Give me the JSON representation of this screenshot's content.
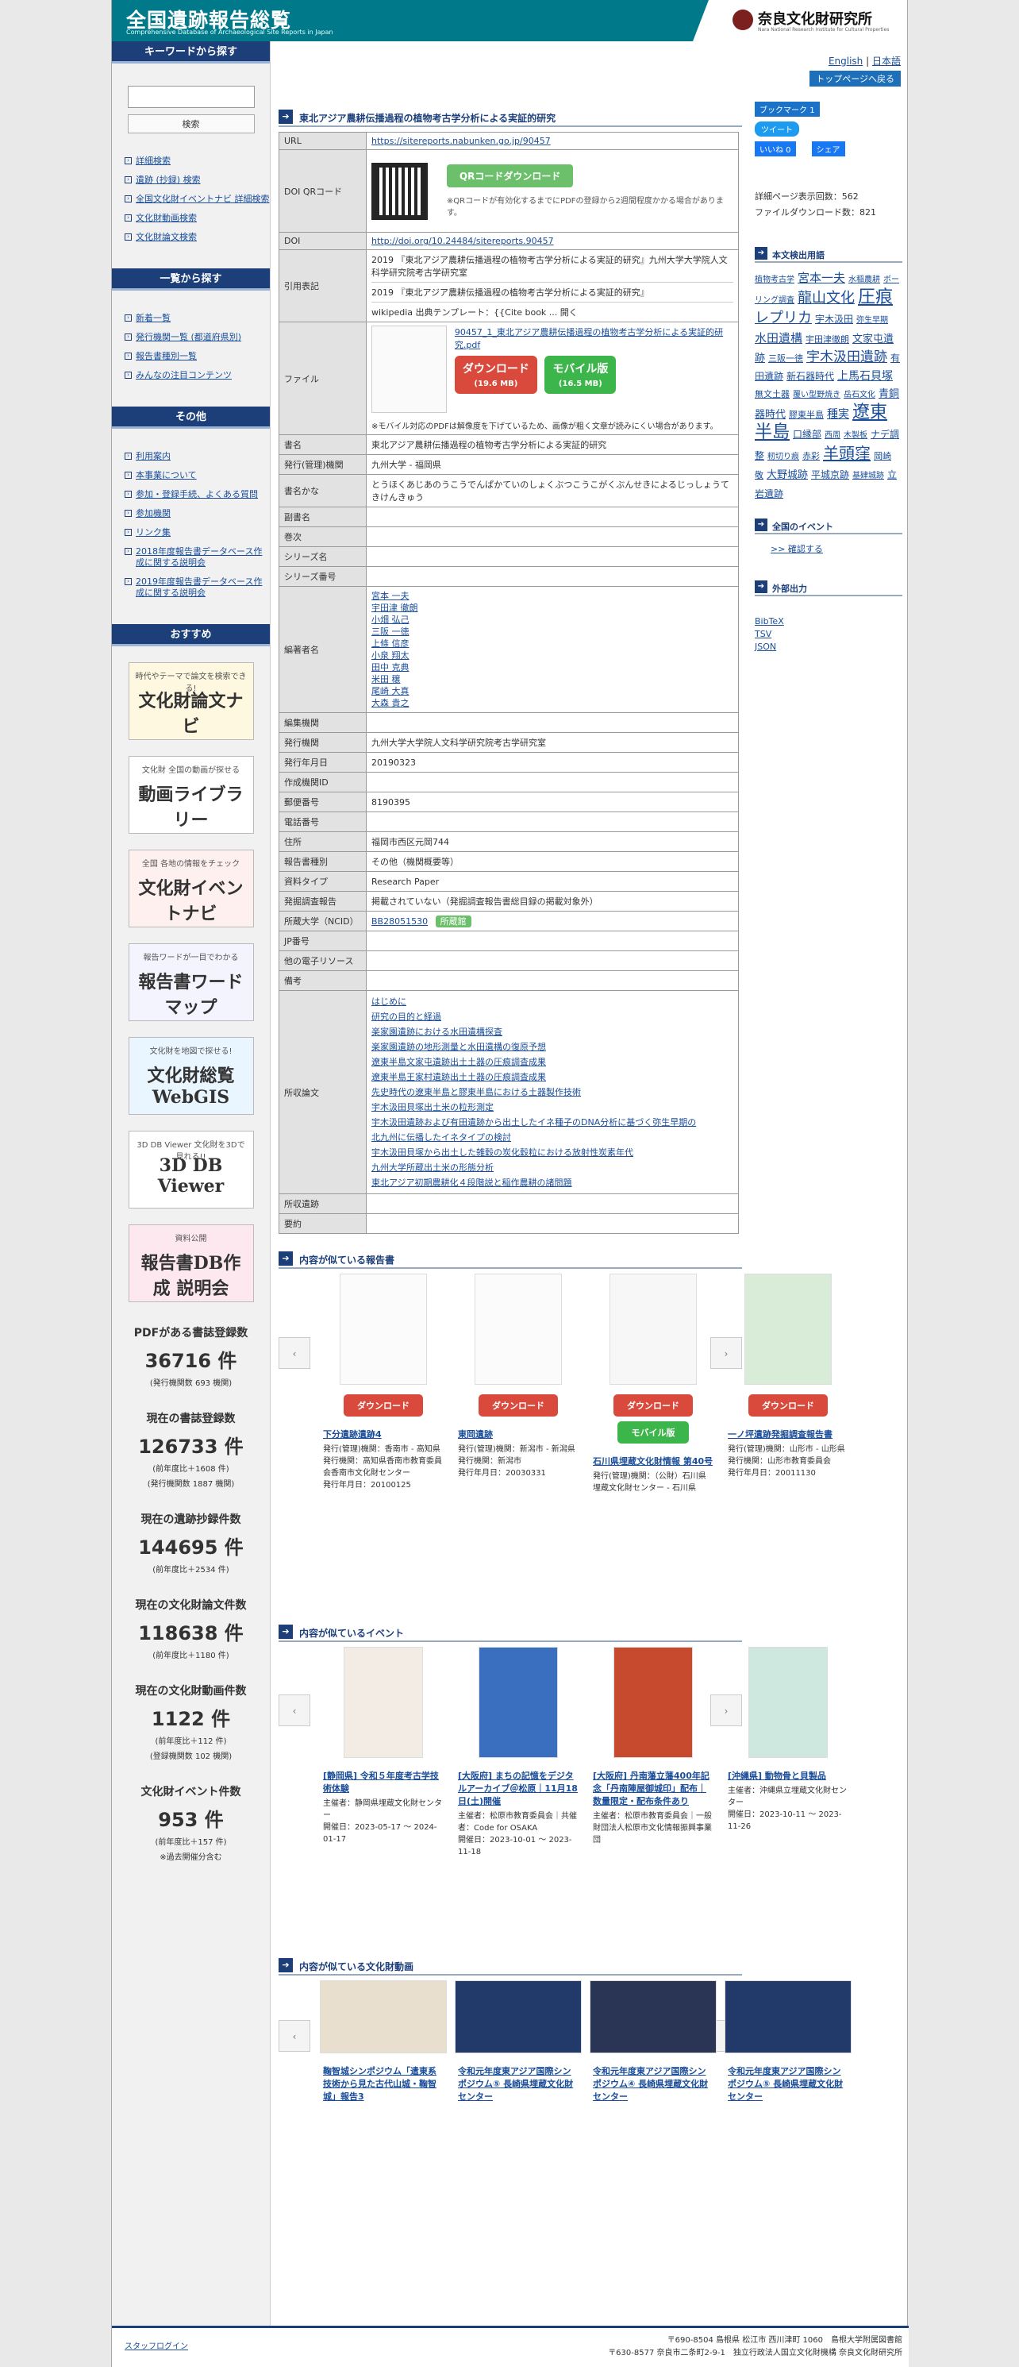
{
  "header": {
    "title": "全国遺跡報告総覧",
    "subtitle": "Comprehensive Database of Archaeological Site Reports in Japan",
    "org": "奈良文化財研究所",
    "org_sub": "Nara National Research Institute for Cultural Properties"
  },
  "lang": {
    "english": "English",
    "sep": "|",
    "japanese": "日本語",
    "top": "トップページへ戻る"
  },
  "sidebar": {
    "search_head": "キーワードから探す",
    "search_button": "検索",
    "search_links": [
      "詳細検索",
      "遺跡 (抄録) 検索",
      "全国文化財イベントナビ 詳細検索",
      "文化財動画検索",
      "文化財論文検索"
    ],
    "list_head": "一覧から探す",
    "list_links": [
      "新着一覧",
      "発行機関一覧 (都道府県別)",
      "報告書種別一覧",
      "みんなの注目コンテンツ"
    ],
    "other_head": "その他",
    "other_links": [
      "利用案内",
      "本事業について",
      "参加・登録手続、よくある質問",
      "参加機関",
      "リンク集",
      "2018年度報告書データベース作成に関する説明会",
      "2019年度報告書データベース作成に関する説明会"
    ],
    "recommend_head": "おすすめ",
    "banners": [
      {
        "small": "時代やテーマで論文を検索できる!",
        "main": "文化財論文ナビ"
      },
      {
        "small": "文化財 全国の動画が探せる",
        "main": "動画ライブラリー"
      },
      {
        "small": "全国 各地の情報をチェック",
        "main": "文化財イベントナビ"
      },
      {
        "small": "報告ワードが一目でわかる",
        "main": "報告書ワードマップ"
      },
      {
        "small": "文化財を地図で探せる!",
        "main": "文化財総覧WebGIS"
      },
      {
        "small": "3D DB Viewer 文化財を3Dで見れる!!",
        "main": "3D DB Viewer"
      },
      {
        "small": "資料公開",
        "main": "報告書DB作成 説明会"
      }
    ],
    "stats": [
      {
        "title": "PDFがある書誌登録数",
        "value": "36716 件",
        "notes": [
          "(発行機関数 693 機関)"
        ]
      },
      {
        "title": "現在の書誌登録数",
        "value": "126733 件",
        "notes": [
          "(前年度比＋1608 件)",
          "(発行機関数 1887 機関)"
        ]
      },
      {
        "title": "現在の遺跡抄録件数",
        "value": "144695 件",
        "notes": [
          "(前年度比＋2534 件)"
        ]
      },
      {
        "title": "現在の文化財論文件数",
        "value": "118638 件",
        "notes": [
          "(前年度比＋1180 件)"
        ]
      },
      {
        "title": "現在の文化財動画件数",
        "value": "1122 件",
        "notes": [
          "(前年度比＋112 件)",
          "(登録機関数 102 機関)"
        ]
      },
      {
        "title": "文化財イベント件数",
        "value": "953 件",
        "notes": [
          "(前年度比＋157 件)",
          "※過去開催分含む"
        ]
      }
    ]
  },
  "main": {
    "title": "東北アジア農耕伝播過程の植物考古学分析による実証的研究",
    "url": "https://sitereports.nabunken.go.jp/90457",
    "qr_button": "QRコードダウンロード",
    "qr_note": "※QRコードが有効化するまでにPDFの登録から2週間程度かかる場合があります。",
    "doi": "http://doi.org/10.24484/sitereports.90457",
    "cite1": "2019 『東北アジア農耕伝播過程の植物考古学分析による実証的研究』九州大学大学院人文科学研究院考古学研究室",
    "cite2": "2019 『東北アジア農耕伝播過程の植物考古学分析による実証的研究』",
    "cite3": "wikipedia 出典テンプレート：{{Cite book ... 開く",
    "file_link": "90457_1_東北アジア農耕伝播過程の植物考古学分析による実証的研究.pdf",
    "dl_label": "ダウンロード",
    "dl_size": "(19.6 MB)",
    "mob_label": "モバイル版",
    "mob_size": "(16.5 MB)",
    "file_note": "※モバイル対応のPDFは解像度を下げているため、画像が粗く文章が読みにくい場合があります。",
    "labels": {
      "url": "URL",
      "qr": "DOI QRコード",
      "doi": "DOI",
      "cite": "引用表記",
      "file": "ファイル",
      "book": "書名",
      "pub": "発行(管理)機関",
      "kana": "書名かな",
      "subtitle": "副書名",
      "vol": "巻次",
      "series": "シリーズ名",
      "seriesno": "シリーズ番号",
      "editors": "編著者名",
      "editorg": "編集機関",
      "issuer": "発行機関",
      "date": "発行年月日",
      "org_id": "作成機関ID",
      "zip": "郵便番号",
      "tel": "電話番号",
      "addr": "住所",
      "type": "報告書種別",
      "material": "資料タイプ",
      "survey": "発掘調査報告",
      "ncid": "所蔵大学（NCID）",
      "jp": "JP番号",
      "elec": "他の電子リソース",
      "note": "備考",
      "contents": "所収論文",
      "sites": "所収遺跡",
      "summary": "要約"
    },
    "book": "東北アジア農耕伝播過程の植物考古学分析による実証的研究",
    "pub": "九州大学 - 福岡県",
    "kana": "とうほくあじあのうこうでんぱかていのしょくぶつこうこがくぶんせきによるじっしょうてきけんきゅう",
    "editors": [
      "宮本 一夫",
      "宇田津 徹朗",
      "小畑 弘己",
      "三阪 一徳",
      "上條 信彦",
      "小泉 翔太",
      "田中 克典",
      "米田 穣",
      "尾崎 大真",
      "大森 貴之"
    ],
    "issuer": "九州大学大学院人文科学研究院考古学研究室",
    "date": "20190323",
    "zip": "8190395",
    "addr": "福岡市西区元岡744",
    "type": "その他（機関概要等）",
    "material": "Research Paper",
    "survey": "掲載されていない（発掘調査報告書総目録の掲載対象外）",
    "ncid": "BB28051530",
    "ncid_btn": "所蔵館",
    "contents": [
      "はじめに",
      "研究の目的と経過",
      "楽家園遺跡における水田遺構探査",
      "楽家園遺跡の地形測量と水田遺構の復原予想",
      "遼東半島文家屯遺跡出土土器の圧痕調査成果",
      "遼東半島王家村遺跡出土土器の圧痕調査成果",
      "先史時代の遼東半島と膠東半島における土器製作技術",
      "宇木汲田貝塚出土米の粒形測定",
      "宇木汲田遺跡および有田遺跡から出土したイネ種子のDNA分析に基づく弥生早期の",
      "北九州に伝播したイネタイプの検討",
      "宇木汲田貝塚から出土した雑穀の炭化穀粒における放射性炭素年代",
      "九州大学所蔵出土米の形態分析",
      "東北アジア初期農耕化４段階説と稲作農耕の諸問題"
    ],
    "related_reports_head": "内容が似ている報告書",
    "related_reports": [
      {
        "title": "下分遺跡遺跡4",
        "meta": [
          "発行(管理)機関：香南市 - 高知県",
          "発行機関：高知県香南市教育委員会香南市文化財センター",
          "発行年月日：20100125"
        ],
        "mobile": false
      },
      {
        "title": "東岡遺跡",
        "meta": [
          "発行(管理)機関：新潟市 - 新潟県",
          "発行機関：新潟市",
          "発行年月日：20030331"
        ],
        "mobile": false
      },
      {
        "title": "石川県埋蔵文化財情報 第40号",
        "meta": [
          "発行(管理)機関：（公財）石川県埋蔵文化財センター - 石川県"
        ],
        "mobile": true
      },
      {
        "title": "一ノ坪遺跡発掘調査報告書",
        "meta": [
          "発行(管理)機関：山形市 - 山形県",
          "発行機関：山形市教育委員会",
          "発行年月日：20011130"
        ],
        "mobile": false
      }
    ],
    "card_dl": "ダウンロード",
    "card_mob": "モバイル版",
    "related_events_head": "内容が似ているイベント",
    "related_events": [
      {
        "title": "[静岡県] 令和５年度考古学技術体験",
        "meta": [
          "主催者：静岡県埋蔵文化財センター",
          "開催日：2023-05-17 ～ 2024-01-17"
        ]
      },
      {
        "title": "[大阪府] まちの記憶をデジタルアーカイブ＠松原｜11月18日(土)開催",
        "meta": [
          "主催者：松原市教育委員会｜共催者：Code for OSAKA",
          "開催日：2023-10-01 ～ 2023-11-18"
        ]
      },
      {
        "title": "[大阪府] 丹南藩立藩400年記念「丹南陣屋御城印」配布｜数量限定・配布条件あり",
        "meta": [
          "主催者：松原市教育委員会｜一般財団法人松原市文化情報振興事業団"
        ]
      },
      {
        "title": "[沖縄県] 動物骨と貝製品",
        "meta": [
          "主催者：沖縄県立埋蔵文化財センター",
          "開催日：2023-10-11 ～ 2023-11-26"
        ]
      }
    ],
    "related_videos_head": "内容が似ている文化財動画",
    "related_videos": [
      {
        "title": "鞠智城シンポジウム「遣東系技術から見た古代山城・鞠智城」報告3"
      },
      {
        "title": "令和元年度東アジア国際シンポジウム⑤ 長崎県埋蔵文化財センター"
      },
      {
        "title": "令和元年度東アジア国際シンポジウム④ 長崎県埋蔵文化財センター"
      },
      {
        "title": "令和元年度東アジア国際シンポジウム⑤ 長崎県埋蔵文化財センター"
      }
    ]
  },
  "right": {
    "bookmark": "ブックマーク",
    "bookmark_count": "1",
    "tweet": "ツイート",
    "like": "いいね 0",
    "share": "シェア",
    "views": "詳細ページ表示回数：562",
    "downloads": "ファイルダウンロード数：821",
    "tags_head": "本文検出用語",
    "tags": [
      "植物考古学",
      "宮本一夫",
      "水稲農耕",
      "ボーリング調査",
      "龍山文化",
      "圧痕",
      "レプリカ",
      "宇木汲田",
      "弥生早期",
      "水田遺構",
      "宇田津徹朗",
      "文家屯遺跡",
      "三阪一徳",
      "宇木汲田遺跡",
      "有田遺跡",
      "新石器時代",
      "上馬石貝塚",
      "無文土器",
      "覆い型野焼き",
      "岳石文化",
      "青銅器時代",
      "膠東半島",
      "種実",
      "遼東半島",
      "口縁部",
      "西周",
      "木製板",
      "ナデ調整",
      "籾切り痕",
      "赤彩",
      "羊頭窪",
      "岡崎敬",
      "大野城跡",
      "平城京跡",
      "基肄城跡",
      "立岩遺跡"
    ],
    "events_head": "全国のイベント",
    "events_link": ">> 確認する",
    "export_head": "外部出力",
    "exports": [
      "BibTeX",
      "TSV",
      "JSON"
    ]
  },
  "footer": {
    "login": "スタッフログイン",
    "addr1": "〒690-8504 島根県 松江市 西川津町 1060　島根大学附属図書館",
    "addr2": "〒630-8577 奈良市二条町2-9-1　独立行政法人国立文化財機構 奈良文化財研究所"
  }
}
